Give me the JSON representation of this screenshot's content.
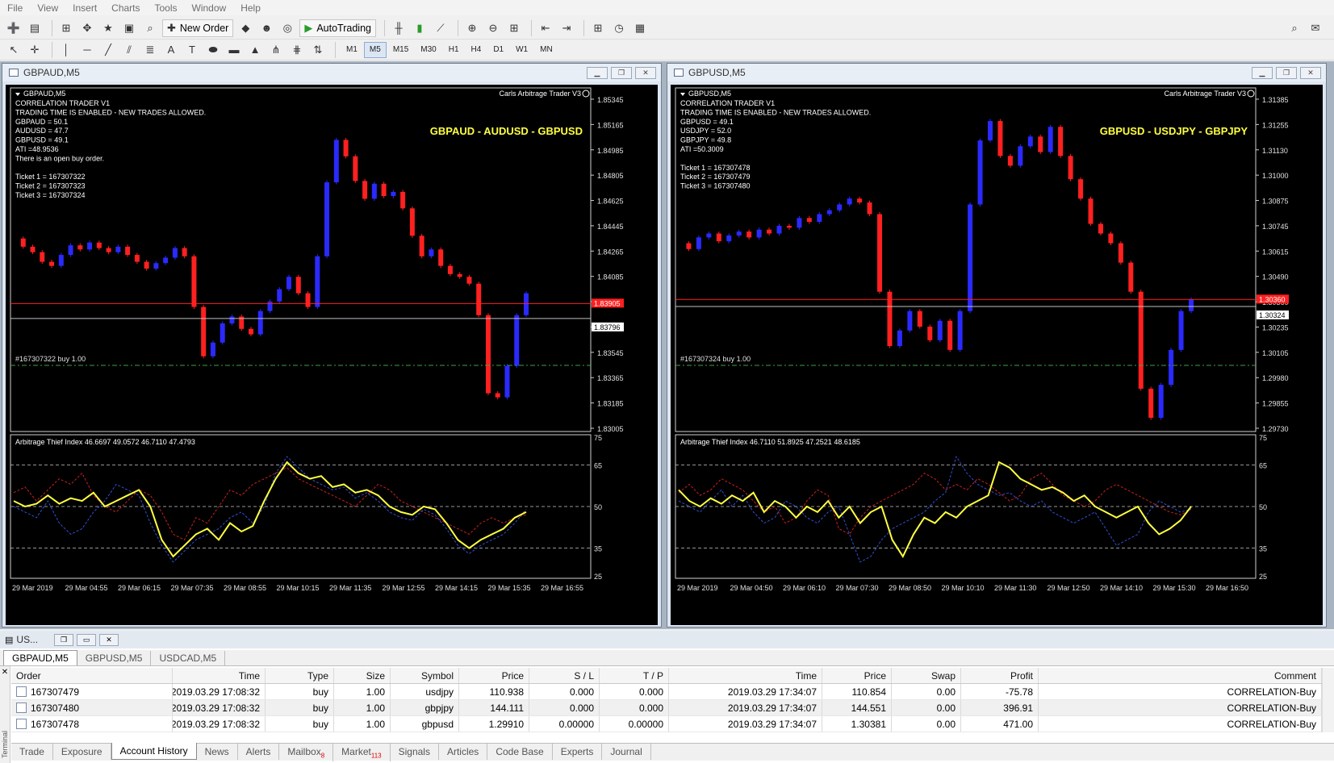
{
  "menu": [
    "File",
    "View",
    "Insert",
    "Charts",
    "Tools",
    "Window",
    "Help"
  ],
  "toolbar": {
    "new_order_label": "New Order",
    "autotrading_label": "AutoTrading",
    "timeframes": [
      "M1",
      "M5",
      "M15",
      "M30",
      "H1",
      "H4",
      "D1",
      "W1",
      "MN"
    ],
    "active_timeframe": "M5"
  },
  "charts": [
    {
      "window_title": "GBPAUD,M5",
      "symbol_label": "GBPAUD,M5",
      "ea_name": "Carls Arbitrage Trader V3",
      "info_lines": [
        "CORRELATION TRADER V1",
        "TRADING TIME IS ENABLED - NEW TRADES ALLOWED.",
        "GBPAUD = 50.1",
        "AUDUSD = 47.7",
        "GBPUSD = 49.1",
        "ATI =48.9536",
        "There is an open buy order.",
        "",
        "Ticket 1 = 167307322",
        "Ticket 2 = 167307323",
        "Ticket 3 = 167307324"
      ],
      "banner": "GBPAUD - AUDUSD - GBPUSD",
      "price_axis": [
        "1.85345",
        "1.85165",
        "1.84985",
        "1.84805",
        "1.84625",
        "1.84445",
        "1.84265",
        "1.84085",
        "1.83905",
        "1.83725",
        "1.83545",
        "1.83365",
        "1.83185",
        "1.83005"
      ],
      "ask_label": "1.83905",
      "bid_label": "1.83796",
      "order_label": "#167307322 buy 1.00",
      "indicator_label": "Arbitrage Thief Index 46.6697 49.0572 46.7110 47.4793",
      "indicator_axis": [
        "75",
        "65",
        "50",
        "35",
        "25"
      ],
      "time_axis": [
        "29 Mar 2019",
        "29 Mar 04:55",
        "29 Mar 06:15",
        "29 Mar 07:35",
        "29 Mar 08:55",
        "29 Mar 10:15",
        "29 Mar 11:35",
        "29 Mar 12:55",
        "29 Mar 14:15",
        "29 Mar 15:35",
        "29 Mar 16:55"
      ],
      "price_range": [
        1.83,
        1.8545
      ],
      "close_series": [
        1.8438,
        1.8432,
        1.8428,
        1.8421,
        1.8418,
        1.8426,
        1.8433,
        1.843,
        1.8435,
        1.8431,
        1.8428,
        1.8432,
        1.8426,
        1.8421,
        1.8416,
        1.842,
        1.8424,
        1.8431,
        1.8425,
        1.8388,
        1.8352,
        1.8362,
        1.8376,
        1.8381,
        1.8372,
        1.8368,
        1.8385,
        1.8392,
        1.8401,
        1.841,
        1.8398,
        1.8388,
        1.8425,
        1.8479,
        1.851,
        1.8498,
        1.848,
        1.8467,
        1.8478,
        1.8469,
        1.8472,
        1.846,
        1.844,
        1.8425,
        1.843,
        1.8418,
        1.8412,
        1.841,
        1.8405,
        1.8382,
        1.8325,
        1.8322,
        1.8345,
        1.8382,
        1.8398
      ],
      "indicator_series": {
        "yellow": [
          52,
          50,
          51,
          54,
          51,
          53,
          52,
          55,
          50,
          52,
          54,
          56,
          50,
          38,
          32,
          36,
          40,
          42,
          38,
          44,
          41,
          43,
          52,
          60,
          66,
          62,
          60,
          61,
          57,
          58,
          55,
          56,
          54,
          50,
          48,
          47,
          50,
          49,
          44,
          38,
          35,
          38,
          40,
          42,
          46,
          48
        ],
        "red": [
          55,
          57,
          52,
          56,
          60,
          58,
          62,
          54,
          50,
          48,
          52,
          56,
          54,
          48,
          40,
          38,
          46,
          44,
          50,
          56,
          54,
          58,
          60,
          62,
          64,
          60,
          58,
          56,
          54,
          52,
          50,
          54,
          58,
          56,
          52,
          50,
          48,
          46,
          44,
          42,
          40,
          44,
          46,
          44,
          46,
          47
        ],
        "blue": [
          50,
          48,
          46,
          52,
          44,
          40,
          42,
          48,
          52,
          58,
          56,
          54,
          44,
          36,
          30,
          34,
          38,
          40,
          42,
          46,
          48,
          44,
          50,
          62,
          68,
          64,
          60,
          58,
          56,
          57,
          53,
          55,
          52,
          48,
          46,
          45,
          49,
          47,
          42,
          36,
          33,
          36,
          38,
          40,
          44,
          49
        ]
      }
    },
    {
      "window_title": "GBPUSD,M5",
      "symbol_label": "GBPUSD,M5",
      "ea_name": "Carls Arbitrage Trader V3",
      "info_lines": [
        "CORRELATION TRADER V1",
        "TRADING TIME IS ENABLED - NEW TRADES ALLOWED.",
        "GBPUSD = 49.1",
        "USDJPY = 52.0",
        "GBPJPY = 49.8",
        "ATI =50.3009",
        "",
        "Ticket 1 = 167307478",
        "Ticket 2 = 167307479",
        "Ticket 3 = 167307480"
      ],
      "banner": "GBPUSD - USDJPY - GBPJPY",
      "price_axis": [
        "1.31385",
        "1.31255",
        "1.31130",
        "1.31000",
        "1.30875",
        "1.30745",
        "1.30615",
        "1.30490",
        "1.30360",
        "1.30235",
        "1.30105",
        "1.29980",
        "1.29855",
        "1.29730"
      ],
      "ask_label": "1.30360",
      "bid_label": "1.30324",
      "order_label": "#167307324 buy 1.00",
      "indicator_label": "Arbitrage Thief Index 46.7110 51.8925 47.2521 48.6185",
      "indicator_axis": [
        "75",
        "65",
        "50",
        "35",
        "25"
      ],
      "time_axis": [
        "29 Mar 2019",
        "29 Mar 04:50",
        "29 Mar 06:10",
        "29 Mar 07:30",
        "29 Mar 08:50",
        "29 Mar 10:10",
        "29 Mar 11:30",
        "29 Mar 12:50",
        "29 Mar 14:10",
        "29 Mar 15:30",
        "29 Mar 16:50"
      ],
      "price_range": [
        1.297,
        1.3143
      ],
      "close_series": [
        1.3065,
        1.3062,
        1.3068,
        1.307,
        1.3066,
        1.3069,
        1.3071,
        1.3068,
        1.3072,
        1.307,
        1.3074,
        1.3073,
        1.3078,
        1.3076,
        1.308,
        1.3082,
        1.3085,
        1.3088,
        1.3086,
        1.308,
        1.304,
        1.3012,
        1.302,
        1.303,
        1.3022,
        1.3015,
        1.3025,
        1.301,
        1.303,
        1.3085,
        1.3118,
        1.3128,
        1.311,
        1.3105,
        1.3115,
        1.312,
        1.3112,
        1.3125,
        1.311,
        1.3098,
        1.3088,
        1.3075,
        1.307,
        1.3065,
        1.3055,
        1.304,
        1.299,
        1.2975,
        1.2992,
        1.301,
        1.303,
        1.3036
      ],
      "indicator_series": {
        "yellow": [
          56,
          52,
          50,
          53,
          51,
          54,
          52,
          55,
          48,
          52,
          50,
          46,
          50,
          48,
          52,
          46,
          50,
          44,
          48,
          50,
          38,
          32,
          40,
          46,
          44,
          48,
          46,
          50,
          52,
          54,
          66,
          64,
          60,
          58,
          56,
          57,
          55,
          52,
          54,
          50,
          48,
          46,
          48,
          50,
          44,
          40,
          42,
          45,
          50
        ],
        "red": [
          55,
          58,
          54,
          56,
          60,
          58,
          56,
          52,
          48,
          50,
          44,
          46,
          52,
          56,
          54,
          42,
          40,
          46,
          50,
          52,
          54,
          56,
          58,
          62,
          60,
          56,
          58,
          56,
          60,
          58,
          55,
          52,
          54,
          60,
          62,
          58,
          54,
          52,
          50,
          52,
          56,
          58,
          56,
          54,
          52,
          50,
          48,
          47,
          49
        ],
        "blue": [
          52,
          50,
          48,
          52,
          56,
          50,
          54,
          48,
          44,
          46,
          52,
          50,
          46,
          44,
          48,
          50,
          40,
          30,
          32,
          38,
          42,
          44,
          46,
          48,
          52,
          55,
          68,
          62,
          58,
          56,
          54,
          55,
          52,
          50,
          52,
          48,
          46,
          44,
          46,
          48,
          42,
          36,
          38,
          40,
          48,
          52,
          50,
          48,
          49
        ]
      }
    }
  ],
  "terminal": {
    "title": "US...",
    "chart_tabs": [
      "GBPAUD,M5",
      "GBPUSD,M5",
      "USDCAD,M5"
    ],
    "active_chart_tab": 0,
    "columns": [
      "Order",
      "Time",
      "Type",
      "Size",
      "Symbol",
      "Price",
      "S / L",
      "T / P",
      "Time",
      "Price",
      "Swap",
      "Profit",
      "Comment"
    ],
    "rows": [
      [
        "167307479",
        "2019.03.29 17:08:32",
        "buy",
        "1.00",
        "usdjpy",
        "110.938",
        "0.000",
        "0.000",
        "2019.03.29 17:34:07",
        "110.854",
        "0.00",
        "-75.78",
        "CORRELATION-Buy"
      ],
      [
        "167307480",
        "2019.03.29 17:08:32",
        "buy",
        "1.00",
        "gbpjpy",
        "144.111",
        "0.000",
        "0.000",
        "2019.03.29 17:34:07",
        "144.551",
        "0.00",
        "396.91",
        "CORRELATION-Buy"
      ],
      [
        "167307478",
        "2019.03.29 17:08:32",
        "buy",
        "1.00",
        "gbpusd",
        "1.29910",
        "0.00000",
        "0.00000",
        "2019.03.29 17:34:07",
        "1.30381",
        "0.00",
        "471.00",
        "CORRELATION-Buy"
      ]
    ],
    "bottom_tabs": [
      "Trade",
      "Exposure",
      "Account History",
      "News",
      "Alerts",
      "Mailbox",
      "Market",
      "Signals",
      "Articles",
      "Code Base",
      "Experts",
      "Journal"
    ],
    "mailbox_badge": "8",
    "market_badge": "113",
    "active_bottom_tab": "Account History",
    "side_label": "Terminal"
  },
  "colors": {
    "bull": "#2a2aff",
    "bear": "#ff2020",
    "yellow": "#ffff40",
    "ask_line": "#ff2020",
    "bid_line": "#c0c0c0"
  }
}
